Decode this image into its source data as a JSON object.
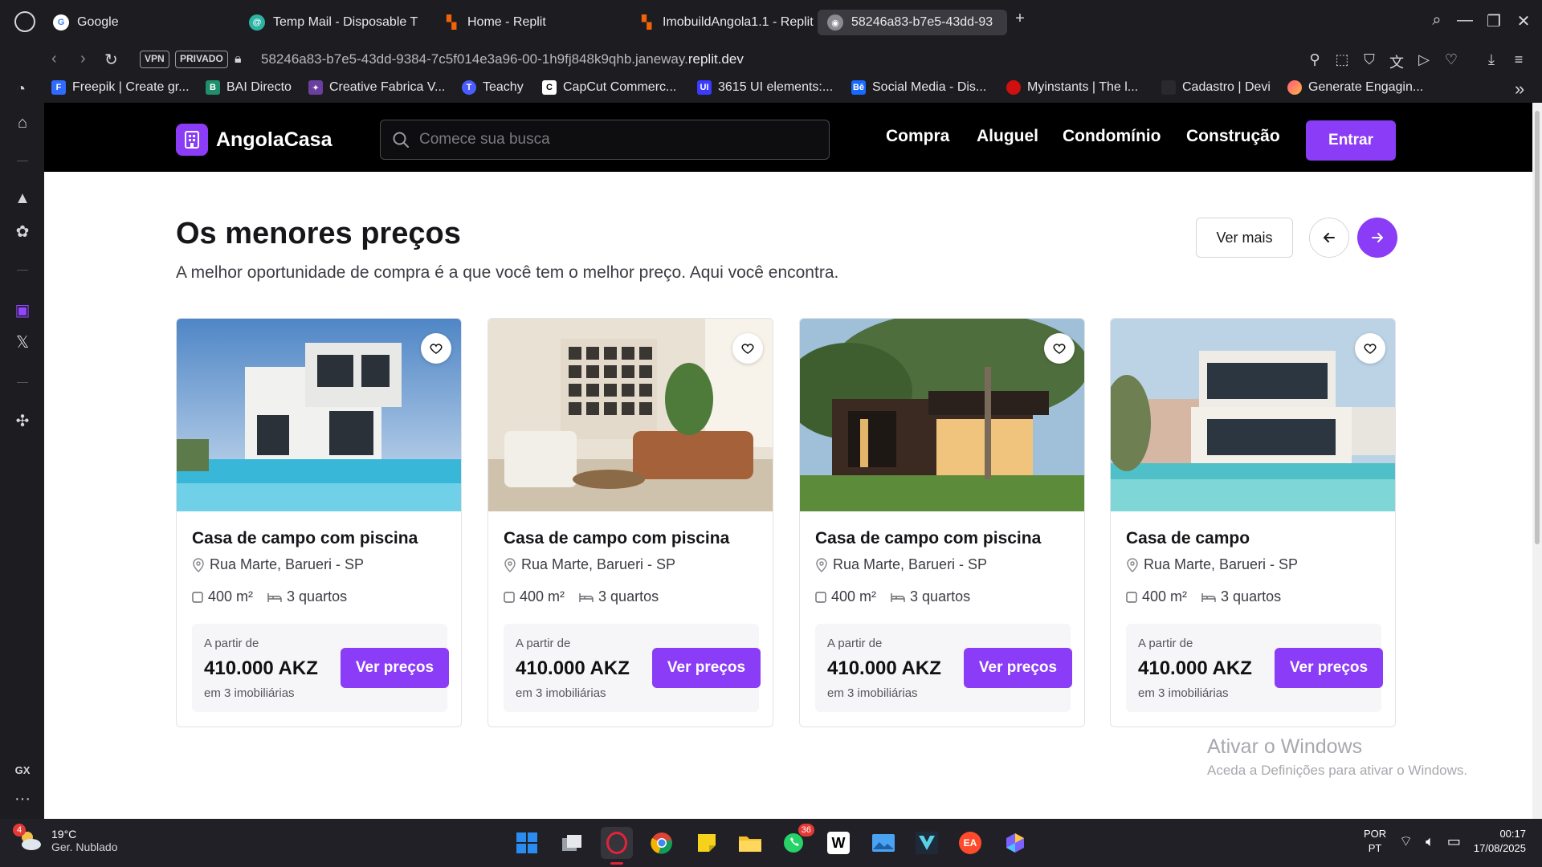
{
  "browser": {
    "tabs": [
      {
        "label": "Google",
        "icon": "google-icon",
        "color": "#ffffff"
      },
      {
        "label": "Temp Mail - Disposable T",
        "icon": "tempmail-icon",
        "color": "#2bb3a3"
      },
      {
        "label": "Home - Replit",
        "icon": "replit-icon",
        "color": "#f26207"
      },
      {
        "label": "ImobuildAngola1.1 - Replit",
        "icon": "replit-icon",
        "color": "#f26207"
      },
      {
        "label": "58246a83-b7e5-43dd-93",
        "icon": "globe-icon",
        "color": "#8a8a90",
        "active": true
      }
    ],
    "vpn_label": "VPN",
    "private_label": "PRIVADO",
    "url_prefix": "58246a83-b7e5-43dd-9384-7c5f014e3a96-00-1h9fj848k9qhb.janeway.",
    "url_domain": "replit.dev",
    "bookmarks": [
      {
        "label": "Freepik | Create gr...",
        "color": "#2f6bff"
      },
      {
        "label": "BAI Directo",
        "color": "#1e8f6a"
      },
      {
        "label": "Creative Fabrica V...",
        "color": "#6b3fa0"
      },
      {
        "label": "Teachy",
        "color": "#4b5cff"
      },
      {
        "label": "CapCut Commerc...",
        "color": "#ffffff"
      },
      {
        "label": "3615 UI elements:...",
        "color": "#3b3bff"
      },
      {
        "label": "Social Media - Dis...",
        "color": "#1769ff"
      },
      {
        "label": "Myinstants | The l...",
        "color": "#d01010"
      },
      {
        "label": "Cadastro | Devi",
        "color": "#2a2a2e"
      },
      {
        "label": "Generate Engagin...",
        "color": "#ff5a7a"
      }
    ]
  },
  "site": {
    "brand": "AngolaCasa",
    "accent": "#8b3cf6",
    "search_placeholder": "Comece sua busca",
    "nav": [
      "Compra",
      "Aluguel",
      "Condomínio",
      "Construção"
    ],
    "login_label": "Entrar"
  },
  "section": {
    "title": "Os menores preços",
    "subtitle": "A melhor oportunidade de compra é a que você tem o melhor preço. Aqui você encontra.",
    "see_more": "Ver mais"
  },
  "cards": [
    {
      "title": "Casa de campo com piscina",
      "address": "Rua Marte, Barueri - SP",
      "area": "400 m²",
      "rooms": "3 quartos",
      "from_label": "A partir de",
      "price": "410.000 AKZ",
      "agencies": "em 3 imobiliárias",
      "cta": "Ver preços"
    },
    {
      "title": "Casa de campo com piscina",
      "address": "Rua Marte, Barueri - SP",
      "area": "400 m²",
      "rooms": "3 quartos",
      "from_label": "A partir de",
      "price": "410.000 AKZ",
      "agencies": "em 3 imobiliárias",
      "cta": "Ver preços"
    },
    {
      "title": "Casa de campo com piscina",
      "address": "Rua Marte, Barueri - SP",
      "area": "400 m²",
      "rooms": "3 quartos",
      "from_label": "A partir de",
      "price": "410.000 AKZ",
      "agencies": "em 3 imobiliárias",
      "cta": "Ver preços"
    },
    {
      "title": "Casa de campo",
      "address": "Rua Marte, Barueri - SP",
      "area": "400 m²",
      "rooms": "3 quartos",
      "from_label": "A partir de",
      "price": "410.000 AKZ",
      "agencies": "em 3 imobiliárias",
      "cta": "Ver preços"
    }
  ],
  "watermark": {
    "title": "Ativar o Windows",
    "subtitle": "Aceda a Definições para ativar o Windows."
  },
  "taskbar": {
    "weather_badge": "4",
    "temperature": "19°C",
    "condition": "Ger. Nublado",
    "whatsapp_badge": "36",
    "lang_top": "POR",
    "lang_bottom": "PT",
    "time": "00:17",
    "date": "17/08/2025",
    "sidebar_gx": "GX"
  }
}
